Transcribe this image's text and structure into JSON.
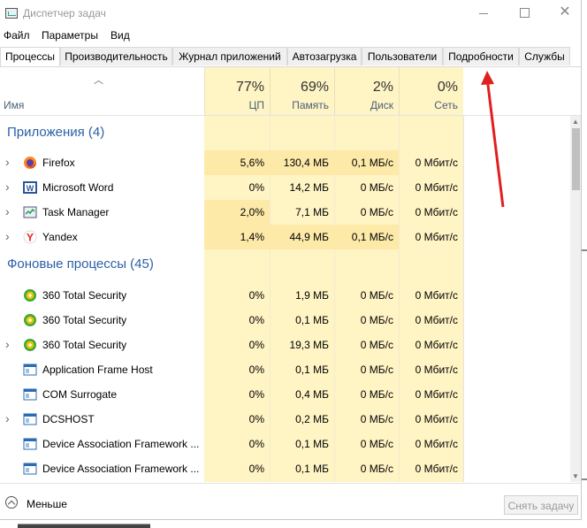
{
  "window": {
    "title": "Диспетчер задач"
  },
  "menu": [
    "Файл",
    "Параметры",
    "Вид"
  ],
  "tabs": [
    {
      "label": "Процессы",
      "active": true
    },
    {
      "label": "Производительность",
      "active": false
    },
    {
      "label": "Журнал приложений",
      "active": false
    },
    {
      "label": "Автозагрузка",
      "active": false
    },
    {
      "label": "Пользователи",
      "active": false
    },
    {
      "label": "Подробности",
      "active": false
    },
    {
      "label": "Службы",
      "active": false
    }
  ],
  "columns": {
    "name": "Имя",
    "cpu": {
      "pct": "77%",
      "label": "ЦП"
    },
    "memory": {
      "pct": "69%",
      "label": "Память"
    },
    "disk": {
      "pct": "2%",
      "label": "Диск"
    },
    "network": {
      "pct": "0%",
      "label": "Сеть"
    }
  },
  "groups": {
    "apps": "Приложения (4)",
    "background": "Фоновые процессы (45)"
  },
  "apps": [
    {
      "name": "Firefox",
      "icon": "firefox-icon",
      "cpu": "5,6%",
      "mem": "130,4 МБ",
      "disk": "0,1 МБ/с",
      "net": "0 Мбит/с",
      "hl": [
        true,
        true,
        true,
        false
      ]
    },
    {
      "name": "Microsoft Word",
      "icon": "word-icon",
      "cpu": "0%",
      "mem": "14,2 МБ",
      "disk": "0 МБ/с",
      "net": "0 Мбит/с",
      "hl": [
        false,
        false,
        false,
        false
      ]
    },
    {
      "name": "Task Manager",
      "icon": "task-manager-icon",
      "cpu": "2,0%",
      "mem": "7,1 МБ",
      "disk": "0 МБ/с",
      "net": "0 Мбит/с",
      "hl": [
        true,
        false,
        false,
        false
      ]
    },
    {
      "name": "Yandex",
      "icon": "yandex-icon",
      "cpu": "1,4%",
      "mem": "44,9 МБ",
      "disk": "0,1 МБ/с",
      "net": "0 Мбит/с",
      "hl": [
        true,
        true,
        true,
        false
      ]
    }
  ],
  "background": [
    {
      "name": "360 Total Security",
      "icon": "security-360-icon",
      "expand": false,
      "cpu": "0%",
      "mem": "1,9 МБ",
      "disk": "0 МБ/с",
      "net": "0 Мбит/с"
    },
    {
      "name": "360 Total Security",
      "icon": "security-360-icon",
      "expand": false,
      "cpu": "0%",
      "mem": "0,1 МБ",
      "disk": "0 МБ/с",
      "net": "0 Мбит/с"
    },
    {
      "name": "360 Total Security",
      "icon": "security-360-icon",
      "expand": true,
      "cpu": "0%",
      "mem": "19,3 МБ",
      "disk": "0 МБ/с",
      "net": "0 Мбит/с"
    },
    {
      "name": "Application Frame Host",
      "icon": "app-frame-icon",
      "expand": false,
      "cpu": "0%",
      "mem": "0,1 МБ",
      "disk": "0 МБ/с",
      "net": "0 Мбит/с"
    },
    {
      "name": "COM Surrogate",
      "icon": "app-frame-icon",
      "expand": false,
      "cpu": "0%",
      "mem": "0,4 МБ",
      "disk": "0 МБ/с",
      "net": "0 Мбит/с"
    },
    {
      "name": "DCSHOST",
      "icon": "app-frame-icon",
      "expand": true,
      "cpu": "0%",
      "mem": "0,2 МБ",
      "disk": "0 МБ/с",
      "net": "0 Мбит/с"
    },
    {
      "name": "Device Association Framework ...",
      "icon": "app-frame-icon",
      "expand": false,
      "cpu": "0%",
      "mem": "0,1 МБ",
      "disk": "0 МБ/с",
      "net": "0 Мбит/с"
    },
    {
      "name": "Device Association Framework ...",
      "icon": "app-frame-icon",
      "expand": false,
      "cpu": "0%",
      "mem": "0,1 МБ",
      "disk": "0 МБ/с",
      "net": "0 Мбит/с"
    }
  ],
  "footer": {
    "less": "Меньше",
    "end_task": "Снять задачу"
  },
  "colors": {
    "highlight": "#fff4c4",
    "highlight_strong": "#fde9a8",
    "group_text": "#2b5fa6",
    "arrow": "#e0201e"
  }
}
